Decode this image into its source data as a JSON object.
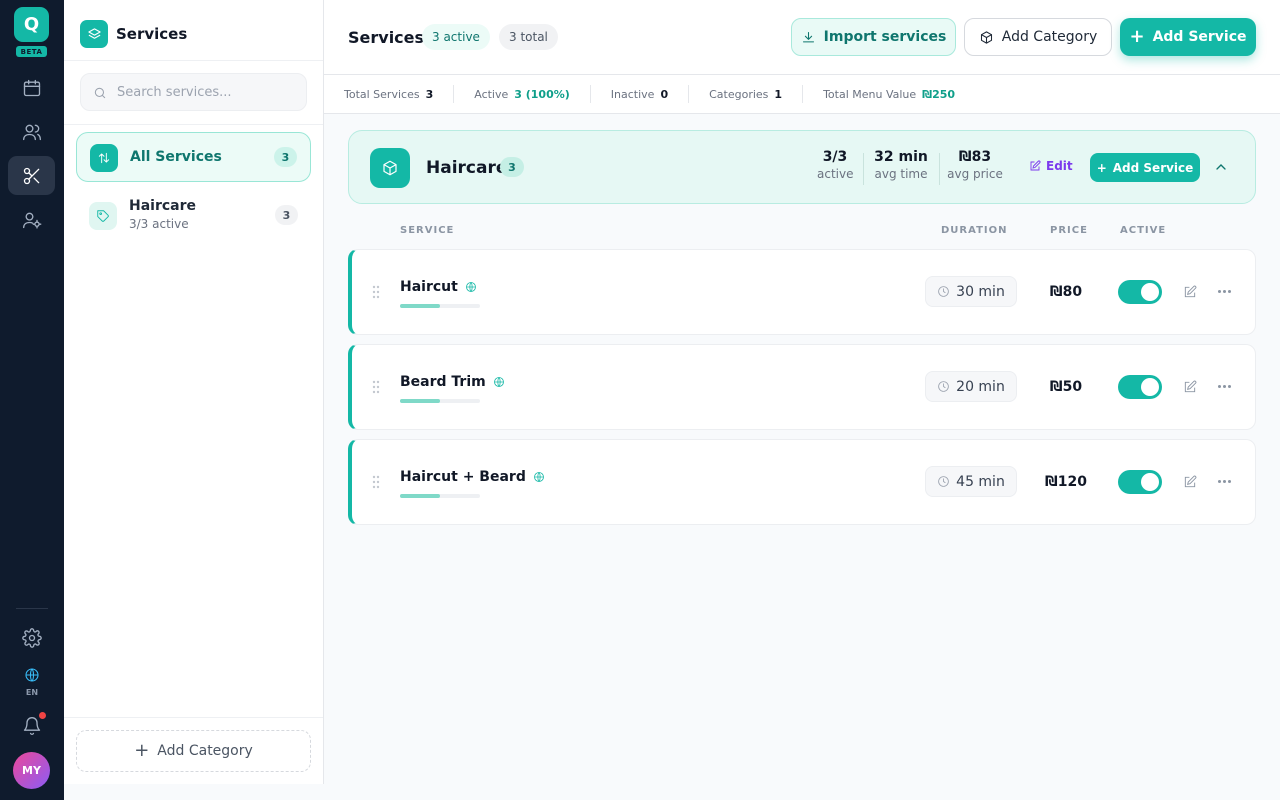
{
  "app": {
    "logo_letter": "Q",
    "beta_label": "BETA",
    "lang_code": "EN",
    "avatar_initials": "MY",
    "accent_color": "#14b8a6",
    "rail_icons": [
      "calendar-icon",
      "users-icon",
      "scissors-icon",
      "user-settings-icon",
      "gear-icon",
      "globe-icon",
      "bell-icon"
    ]
  },
  "sidebar": {
    "title": "Services",
    "search_placeholder": "Search services...",
    "categories": [
      {
        "name": "All Services",
        "count": "3",
        "active": true
      },
      {
        "name": "Haircare",
        "subtitle": "3/3 active",
        "count": "3",
        "active": false
      }
    ],
    "add_category_label": "Add Category"
  },
  "header": {
    "title": "Services",
    "active_pill": "3 active",
    "total_pill": "3 total",
    "import_label": "Import services",
    "add_category_label": "Add Category",
    "add_service_label": "Add Service"
  },
  "stats": [
    {
      "label": "Total Services",
      "value": "3"
    },
    {
      "label": "Active",
      "value": "3 (100%)"
    },
    {
      "label": "Inactive",
      "value": "0"
    },
    {
      "label": "Categories",
      "value": "1"
    },
    {
      "label": "Total Menu Value",
      "value": "₪250"
    }
  ],
  "category_card": {
    "name": "Haircare",
    "count": "3",
    "stats": [
      {
        "value": "3/3",
        "label": "active"
      },
      {
        "value": "32 min",
        "label": "avg time"
      },
      {
        "value": "₪83",
        "label": "avg price"
      }
    ],
    "edit_label": "Edit",
    "add_service_label": "Add Service"
  },
  "table": {
    "headers": {
      "service": "SERVICE",
      "duration": "DURATION",
      "price": "PRICE",
      "active": "ACTIVE"
    },
    "rows": [
      {
        "name": "Haircut",
        "duration": "30 min",
        "price": "₪80",
        "active": true,
        "popularity": 0.5
      },
      {
        "name": "Beard Trim",
        "duration": "20 min",
        "price": "₪50",
        "active": true,
        "popularity": 0.5
      },
      {
        "name": "Haircut + Beard",
        "duration": "45 min",
        "price": "₪120",
        "active": true,
        "popularity": 0.5
      }
    ]
  }
}
